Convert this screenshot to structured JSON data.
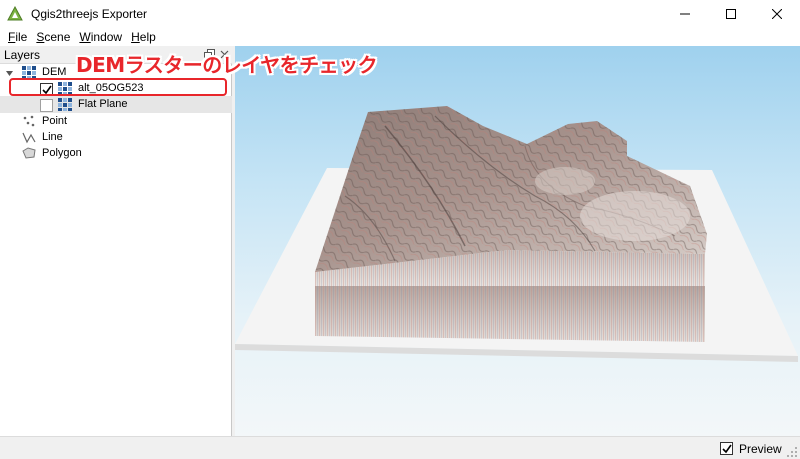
{
  "window": {
    "title": "Qgis2threejs Exporter",
    "icon": "qgis2threejs-logo-icon",
    "controls": [
      "minimize-icon",
      "maximize-icon",
      "close-icon"
    ]
  },
  "menu": {
    "items": [
      {
        "mnemonic": "F",
        "rest": "ile"
      },
      {
        "mnemonic": "S",
        "rest": "cene"
      },
      {
        "mnemonic": "W",
        "rest": "indow"
      },
      {
        "mnemonic": "H",
        "rest": "elp"
      }
    ]
  },
  "layers_panel": {
    "title": "Layers",
    "groups": {
      "dem": {
        "label": "DEM",
        "expanded": true,
        "icon": "raster-layer-icon"
      },
      "point": {
        "label": "Point",
        "icon": "point-layer-icon"
      },
      "line": {
        "label": "Line",
        "icon": "line-layer-icon"
      },
      "polygon": {
        "label": "Polygon",
        "icon": "polygon-layer-icon"
      }
    },
    "dem_layers": [
      {
        "label": "alt_05OG523",
        "checked": true,
        "highlighted": true
      },
      {
        "label": "Flat Plane",
        "checked": false,
        "selected": true
      }
    ]
  },
  "annotation": {
    "text": "DEMラスターのレイヤをチェック",
    "color": "#e8262b"
  },
  "statusbar": {
    "preview_label": "Preview",
    "preview_checked": true
  },
  "colors": {
    "accent_red": "#e8262b",
    "sky_top": "#9fd1ee",
    "plane": "#f4f4f4",
    "terrain": "#b8a49e"
  }
}
